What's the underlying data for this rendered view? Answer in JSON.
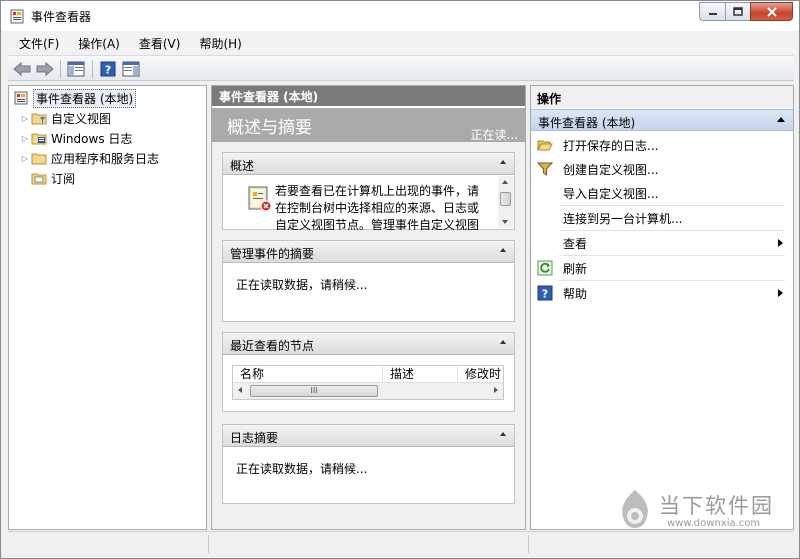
{
  "window": {
    "title": "事件查看器",
    "controls": {
      "minimize": "minimize-icon",
      "maximize": "maximize-icon",
      "close": "close-icon"
    }
  },
  "menu": [
    "文件(F)",
    "操作(A)",
    "查看(V)",
    "帮助(H)"
  ],
  "toolbar": {
    "buttons": [
      "back-arrow-icon",
      "forward-arrow-icon",
      "show-hide-tree-icon",
      "help-icon",
      "show-hide-action-pane-icon"
    ]
  },
  "tree": {
    "root": "事件查看器 (本地)",
    "items": [
      {
        "label": "自定义视图",
        "expandable": true
      },
      {
        "label": "Windows 日志",
        "expandable": true
      },
      {
        "label": "应用程序和服务日志",
        "expandable": true
      },
      {
        "label": "订阅",
        "expandable": false
      }
    ]
  },
  "center": {
    "header": "事件查看器 (本地)",
    "banner_title": "概述与摘要",
    "banner_status": "正在读...",
    "overview": {
      "title": "概述",
      "text": "若要查看已在计算机上出现的事件，请在控制台树中选择相应的来源、日志或自定义视图节点。管理事件自定义视图"
    },
    "admin_summary": {
      "title": "管理事件的摘要",
      "text": "正在读取数据，请稍候..."
    },
    "recent_nodes": {
      "title": "最近查看的节点",
      "columns": [
        "名称",
        "描述",
        "修改时"
      ],
      "scroll_thumb": "III"
    },
    "log_summary": {
      "title": "日志摘要",
      "text": "正在读取数据，请稍候..."
    }
  },
  "actions": {
    "header": "操作",
    "group": "事件查看器 (本地)",
    "items": [
      {
        "label": "打开保存的日志...",
        "icon": "open-folder-icon",
        "submenu": false
      },
      {
        "label": "创建自定义视图...",
        "icon": "filter-icon",
        "submenu": false
      },
      {
        "label": "导入自定义视图...",
        "icon": "",
        "submenu": false
      },
      {
        "label": "连接到另一台计算机...",
        "icon": "",
        "submenu": false
      },
      {
        "label": "查看",
        "icon": "",
        "submenu": true
      },
      {
        "label": "刷新",
        "icon": "refresh-icon",
        "submenu": false
      },
      {
        "label": "帮助",
        "icon": "help-icon",
        "submenu": true
      }
    ]
  },
  "watermark": {
    "title": "当下软件园",
    "url": "www.downxia.com"
  },
  "colors": {
    "accent": "#c4d5ec",
    "header_gray": "#7a7a7a",
    "banner_gray": "#aaaaaa",
    "close_red": "#c7442d"
  }
}
